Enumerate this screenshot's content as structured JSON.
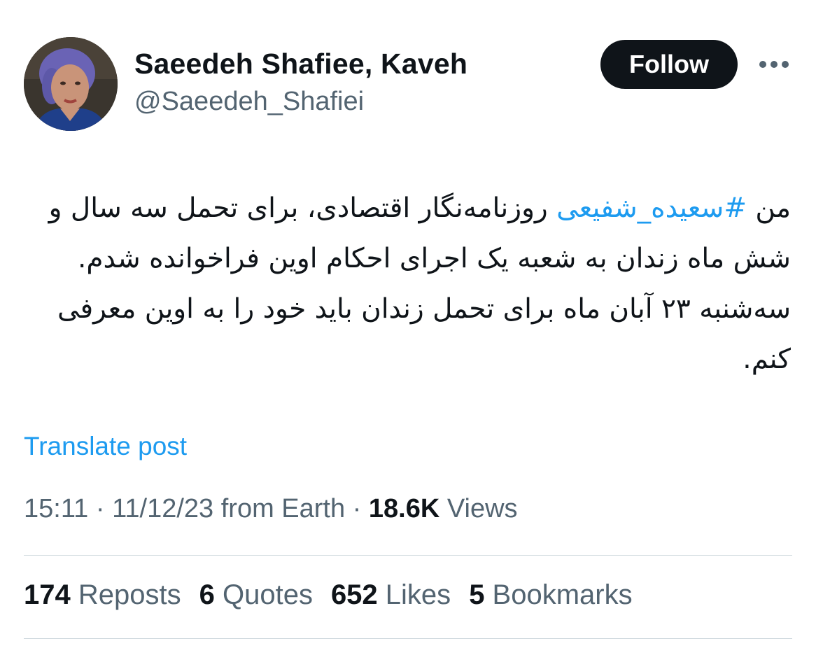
{
  "author": {
    "display_name": "Saeedeh Shafiee, Kaveh",
    "handle": "@Saeedeh_Shafiei",
    "avatar_icon": "profile-photo"
  },
  "header": {
    "follow_label": "Follow",
    "more_icon": "ellipsis-icon"
  },
  "post": {
    "text_before_hashtag": "من ",
    "hashtag": "#سعیده_شفیعی",
    "text_after_hashtag": " روزنامه‌نگار اقتصادی، برای تحمل سه سال و شش ماه زندان به شعبه یک اجرای احکام اوین فراخوانده شدم. سه‌شنبه ۲۳ آبان ماه برای تحمل زندان باید خود را به اوین معرفی کنم.",
    "translate_label": "Translate post"
  },
  "meta": {
    "time": "15:11",
    "separator": " · ",
    "date": "11/12/23",
    "location": " from Earth",
    "views_count": "18.6K",
    "views_label": " Views"
  },
  "stats": [
    {
      "count": "174",
      "label": " Reposts"
    },
    {
      "count": "6",
      "label": " Quotes"
    },
    {
      "count": "652",
      "label": " Likes"
    },
    {
      "count": "5",
      "label": " Bookmarks"
    }
  ],
  "colors": {
    "link": "#1d9bf0",
    "text_primary": "#0f1419",
    "text_secondary": "#536471",
    "divider": "#cfd9de"
  }
}
